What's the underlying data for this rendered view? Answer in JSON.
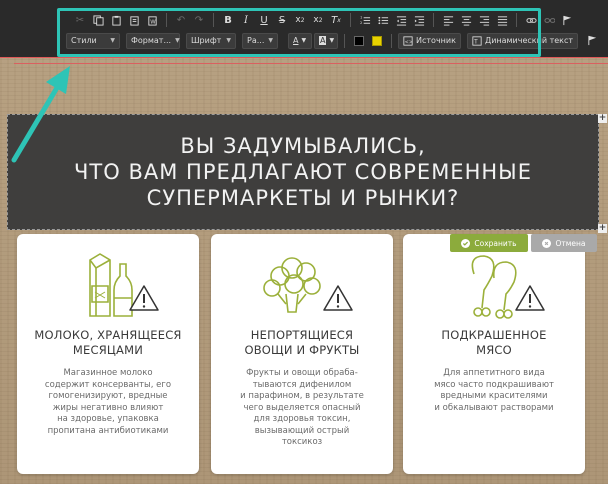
{
  "toolbar": {
    "styles": "Стили",
    "format": "Формат...",
    "font": "Шрифт",
    "size": "Ра...",
    "text_color": "A",
    "bg_color": "A",
    "source": "Источник",
    "dynamic_text": "Динамический текст"
  },
  "headline": {
    "text": "ВЫ ЗАДУМЫВАЛИСЬ,\nЧТО ВАМ ПРЕДЛАГАЮТ СОВРЕМЕННЫЕ\nСУПЕРМАРКЕТЫ И РЫНКИ?"
  },
  "actions": {
    "save": "Сохранить",
    "cancel": "Отмена"
  },
  "cards": [
    {
      "title": "МОЛОКО, ХРАНЯЩЕЕСЯ\nМЕСЯЦАМИ",
      "desc": "Магазинное молоко\nсодержит консерванты, его\nгомогенизируют, вредные\nжиры негативно влияют\nна здоровье, упаковка\nпропитана антибиотиками"
    },
    {
      "title": "НЕПОРТЯЩИЕСЯ\nОВОЩИ И ФРУКТЫ",
      "desc": "Фрукты и овощи обраба-\nтываются  дифенилом\nи парафином, в результате\nчего выделяется опасный\nдля здоровья  токсин,\nвызывающий острый\nтоксикоз"
    },
    {
      "title": "ПОДКРАШЕННОЕ\nМЯСО",
      "desc": "Для аппетитного вида\nмясо часто подкрашивают\nвредными красителями\nи обкалывают растворами"
    }
  ],
  "colors": {
    "accent_frame": "#2ec4b6",
    "icon_green": "#9bb03a",
    "save_green": "#8cab3c"
  }
}
